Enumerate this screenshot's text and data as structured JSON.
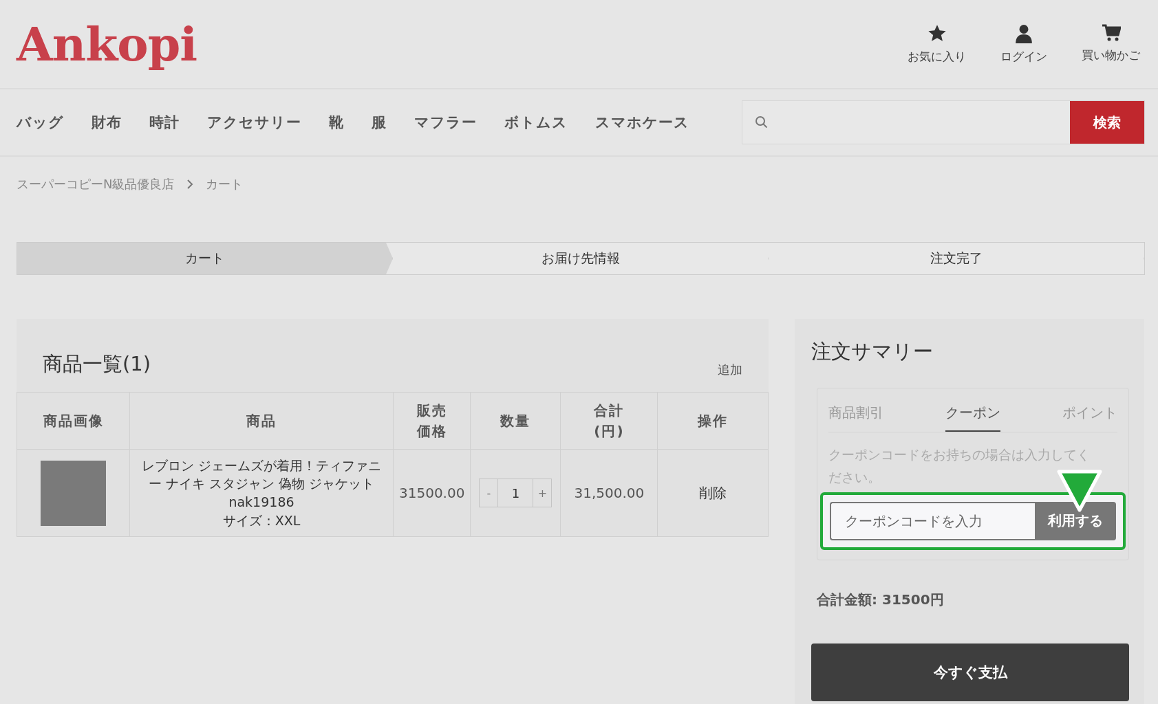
{
  "header": {
    "logo": "Ankopi",
    "actions": [
      {
        "kind": "star",
        "label": "お気に入り"
      },
      {
        "kind": "user",
        "label": "ログイン"
      },
      {
        "kind": "cart",
        "label": "買い物かご"
      }
    ]
  },
  "nav": {
    "items": [
      "バッグ",
      "財布",
      "時計",
      "アクセサリー",
      "靴",
      "服",
      "マフラー",
      "ボトムス",
      "スマホケース"
    ],
    "search_button": "検索"
  },
  "breadcrumb": [
    "スーパーコピーN級品優良店",
    "カート"
  ],
  "steps": [
    {
      "label": "カート",
      "selected": true
    },
    {
      "label": "お届け先情報",
      "selected": false
    },
    {
      "label": "注文完了",
      "selected": false
    }
  ],
  "cart": {
    "title": "商品一覧(1)",
    "add_link": "追加",
    "columns": [
      "商品画像",
      "商品",
      "販売価格",
      "数量",
      "合計(円)",
      "操作"
    ],
    "rows": [
      {
        "name": "レブロン ジェームズが着用！ティファニー ナイキ スタジャン 偽物 ジャケット",
        "code": "nak19186",
        "size": "サイズ：XXL",
        "price": "31500.00",
        "minus": "-",
        "quantity": "1",
        "plus": "+",
        "total": "31,500.00",
        "action": "削除"
      }
    ]
  },
  "summary": {
    "title": "注文サマリー",
    "tabs": [
      {
        "label": "商品割引",
        "selected": false
      },
      {
        "label": "クーポン",
        "selected": true
      },
      {
        "label": "ポイント",
        "selected": false
      }
    ],
    "hint": "クーポンコードをお持ちの場合は入力してください。",
    "placeholder": "クーポンコードを入力",
    "apply_button": "利用する",
    "total": "合計金額: 31500円",
    "pay_button": "今すぐ支払"
  }
}
